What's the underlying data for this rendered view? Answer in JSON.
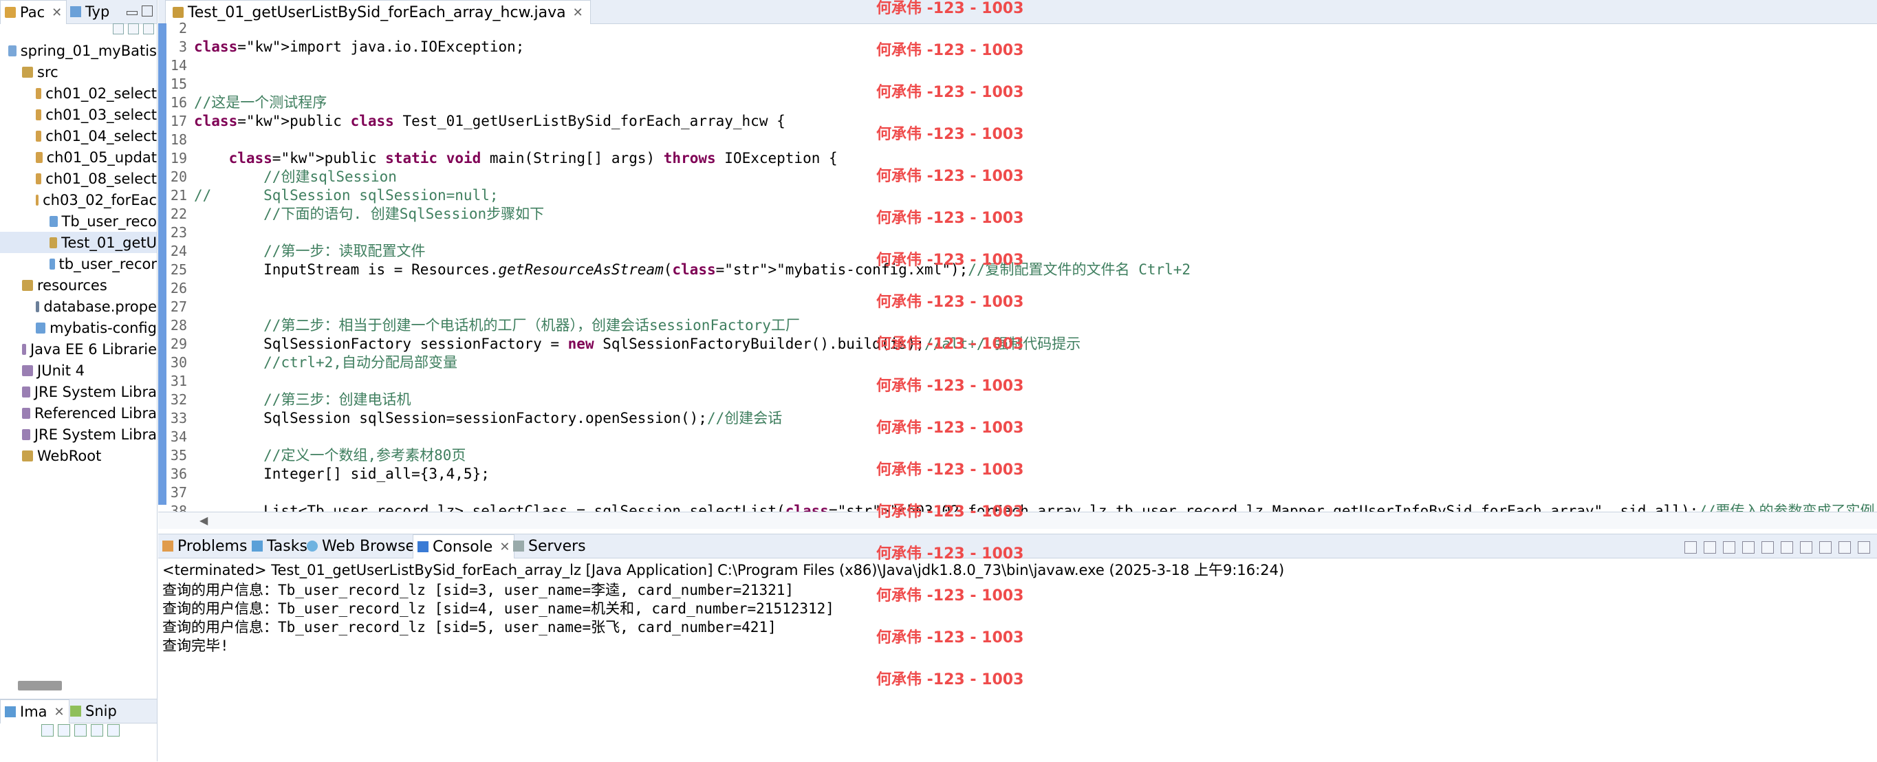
{
  "left_panel": {
    "tabs": [
      {
        "label": "Pac"
      },
      {
        "label": "Typ"
      }
    ],
    "tree": [
      {
        "label": "spring_01_myBatis",
        "indent": 0
      },
      {
        "label": "src",
        "indent": 1
      },
      {
        "label": "ch01_02_select",
        "indent": 2
      },
      {
        "label": "ch01_03_select",
        "indent": 2
      },
      {
        "label": "ch01_04_select",
        "indent": 2
      },
      {
        "label": "ch01_05_updat",
        "indent": 2
      },
      {
        "label": "ch01_08_select",
        "indent": 2
      },
      {
        "label": "ch03_02_forEac",
        "indent": 2
      },
      {
        "label": "Tb_user_reco",
        "indent": 3
      },
      {
        "label": "Test_01_getU",
        "indent": 3,
        "selected": true
      },
      {
        "label": "tb_user_recor",
        "indent": 3
      },
      {
        "label": "resources",
        "indent": 1
      },
      {
        "label": "database.prope",
        "indent": 2
      },
      {
        "label": "mybatis-config",
        "indent": 2
      },
      {
        "label": "Java EE 6 Librarie",
        "indent": 1
      },
      {
        "label": "JUnit 4",
        "indent": 1
      },
      {
        "label": "JRE System Libra",
        "indent": 1
      },
      {
        "label": "Referenced Libra",
        "indent": 1
      },
      {
        "label": "JRE System Libra",
        "indent": 1
      },
      {
        "label": "WebRoot",
        "indent": 1
      }
    ]
  },
  "left_bottom": {
    "tabs": [
      {
        "label": "Ima"
      },
      {
        "label": "Snip"
      }
    ]
  },
  "editor": {
    "tab_title": "Test_01_getUserListBySid_forEach_array_hcw.java",
    "lines": [
      {
        "num": "2",
        "text": ""
      },
      {
        "num": "3",
        "text": "import java.io.IOException;"
      },
      {
        "num": "14",
        "text": ""
      },
      {
        "num": "15",
        "text": ""
      },
      {
        "num": "16",
        "text": "//这是一个测试程序"
      },
      {
        "num": "17",
        "text": "public class Test_01_getUserListBySid_forEach_array_hcw {"
      },
      {
        "num": "18",
        "text": ""
      },
      {
        "num": "19",
        "text": "    public static void main(String[] args) throws IOException {"
      },
      {
        "num": "20",
        "text": "        //创建sqlSession"
      },
      {
        "num": "21",
        "text": "//      SqlSession sqlSession=null;"
      },
      {
        "num": "22",
        "text": "        //下面的语句. 创建SqlSession步骤如下"
      },
      {
        "num": "23",
        "text": ""
      },
      {
        "num": "24",
        "text": "        //第一步：读取配置文件"
      },
      {
        "num": "25",
        "text": "        InputStream is = Resources.getResourceAsStream(\"mybatis-config.xml\");//复制配置文件的文件名 Ctrl+2"
      },
      {
        "num": "26",
        "text": ""
      },
      {
        "num": "27",
        "text": ""
      },
      {
        "num": "28",
        "text": "        //第二步：相当于创建一个电话机的工厂（机器），创建会话sessionFactory工厂"
      },
      {
        "num": "29",
        "text": "        SqlSessionFactory sessionFactory = new SqlSessionFactoryBuilder().build(is);//alt+/ 强制代码提示"
      },
      {
        "num": "30",
        "text": "        //ctrl+2,自动分配局部变量"
      },
      {
        "num": "31",
        "text": ""
      },
      {
        "num": "32",
        "text": "        //第三步：创建电话机"
      },
      {
        "num": "33",
        "text": "        SqlSession sqlSession=sessionFactory.openSession();//创建会话"
      },
      {
        "num": "34",
        "text": ""
      },
      {
        "num": "35",
        "text": "        //定义一个数组,参考素材80页"
      },
      {
        "num": "36",
        "text": "        Integer[] sid_all={3,4,5};"
      },
      {
        "num": "37",
        "text": ""
      },
      {
        "num": "38",
        "text": "        List<Tb_user_record_lz> selectClass = sqlSession.selectList(\"ch03_02_forEach_array.lz.tb_user_record_lz_Mapper.getUserInfoBySid_forEach_array\", sid_all);//要传入的参数变成了实例"
      }
    ]
  },
  "console": {
    "tabs": [
      {
        "label": "Problems"
      },
      {
        "label": "Tasks"
      },
      {
        "label": "Web Browser"
      },
      {
        "label": "Console"
      },
      {
        "label": "Servers"
      }
    ],
    "header": "<terminated> Test_01_getUserListBySid_forEach_array_lz [Java Application] C:\\Program Files (x86)\\Java\\jdk1.8.0_73\\bin\\javaw.exe (2025-3-18 上午9:16:24)",
    "lines": [
      "查询的用户信息：Tb_user_record_lz [sid=3, user_name=李逵, card_number=21321]",
      "查询的用户信息：Tb_user_record_lz [sid=4, user_name=机关和, card_number=21512312]",
      "查询的用户信息：Tb_user_record_lz [sid=5, user_name=张飞, card_number=421]",
      "查询完毕!"
    ]
  },
  "watermark": {
    "text": "何承伟 -123 - 1003",
    "color": "#ef4b4b"
  }
}
